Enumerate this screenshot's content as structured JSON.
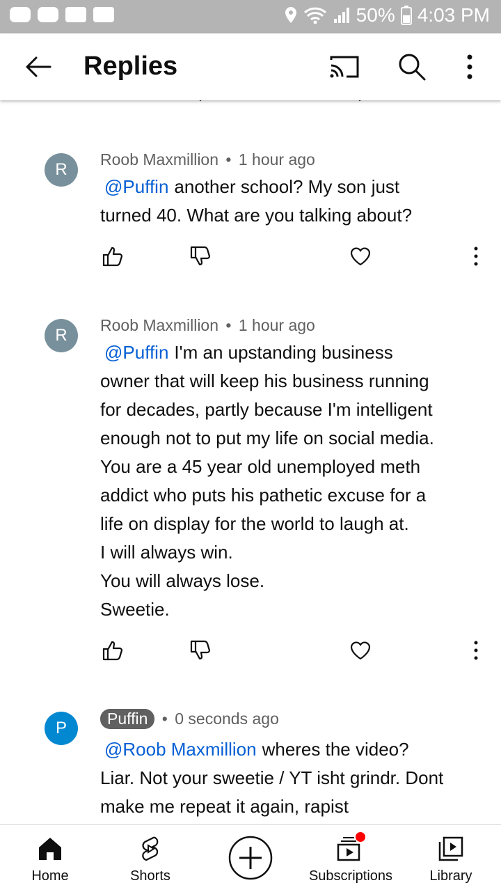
{
  "status_bar": {
    "battery": "50%",
    "time": "4:03 PM"
  },
  "app_bar": {
    "title": "Replies"
  },
  "comments": [
    {
      "avatar": "R",
      "avatar_color": "#78909c",
      "author": "Roob Maxmillion",
      "separator": "•",
      "time": "1 hour ago",
      "mention": "@Puffin",
      "lines": [
        "another school? My son just",
        "turned 40.  What are you talking about?"
      ]
    },
    {
      "avatar": "R",
      "avatar_color": "#78909c",
      "author": "Roob Maxmillion",
      "separator": "•",
      "time": "1 hour ago",
      "mention": "@Puffin",
      "lines": [
        "I'm an upstanding business",
        "owner that will keep his business running",
        "for decades, partly because I'm intelligent",
        "enough not to put my life on social media.",
        "You are a 45 year old unemployed meth",
        "addict who puts his pathetic excuse for a",
        "life on display for the world to laugh at.",
        "I will always win.",
        "You will always lose.",
        "Sweetie."
      ]
    },
    {
      "avatar": "P",
      "avatar_color": "#0288d1",
      "author": "Puffin",
      "separator": "•",
      "time": "0 seconds ago",
      "mention": "@Roob Maxmillion",
      "lines": [
        "wheres the video?",
        "Liar. Not your sweetie / YT isht grindr. Dont",
        "make me repeat it again, rapist"
      ]
    }
  ],
  "bottom_nav": [
    {
      "label": "Home",
      "icon": "home-icon"
    },
    {
      "label": "Shorts",
      "icon": "shorts-icon"
    },
    {
      "label": "",
      "icon": "create-icon"
    },
    {
      "label": "Subscriptions",
      "icon": "subscriptions-icon"
    },
    {
      "label": "Library",
      "icon": "library-icon"
    }
  ],
  "colors": {
    "link": "#065fd4",
    "notification_dot": "#ff0000"
  }
}
